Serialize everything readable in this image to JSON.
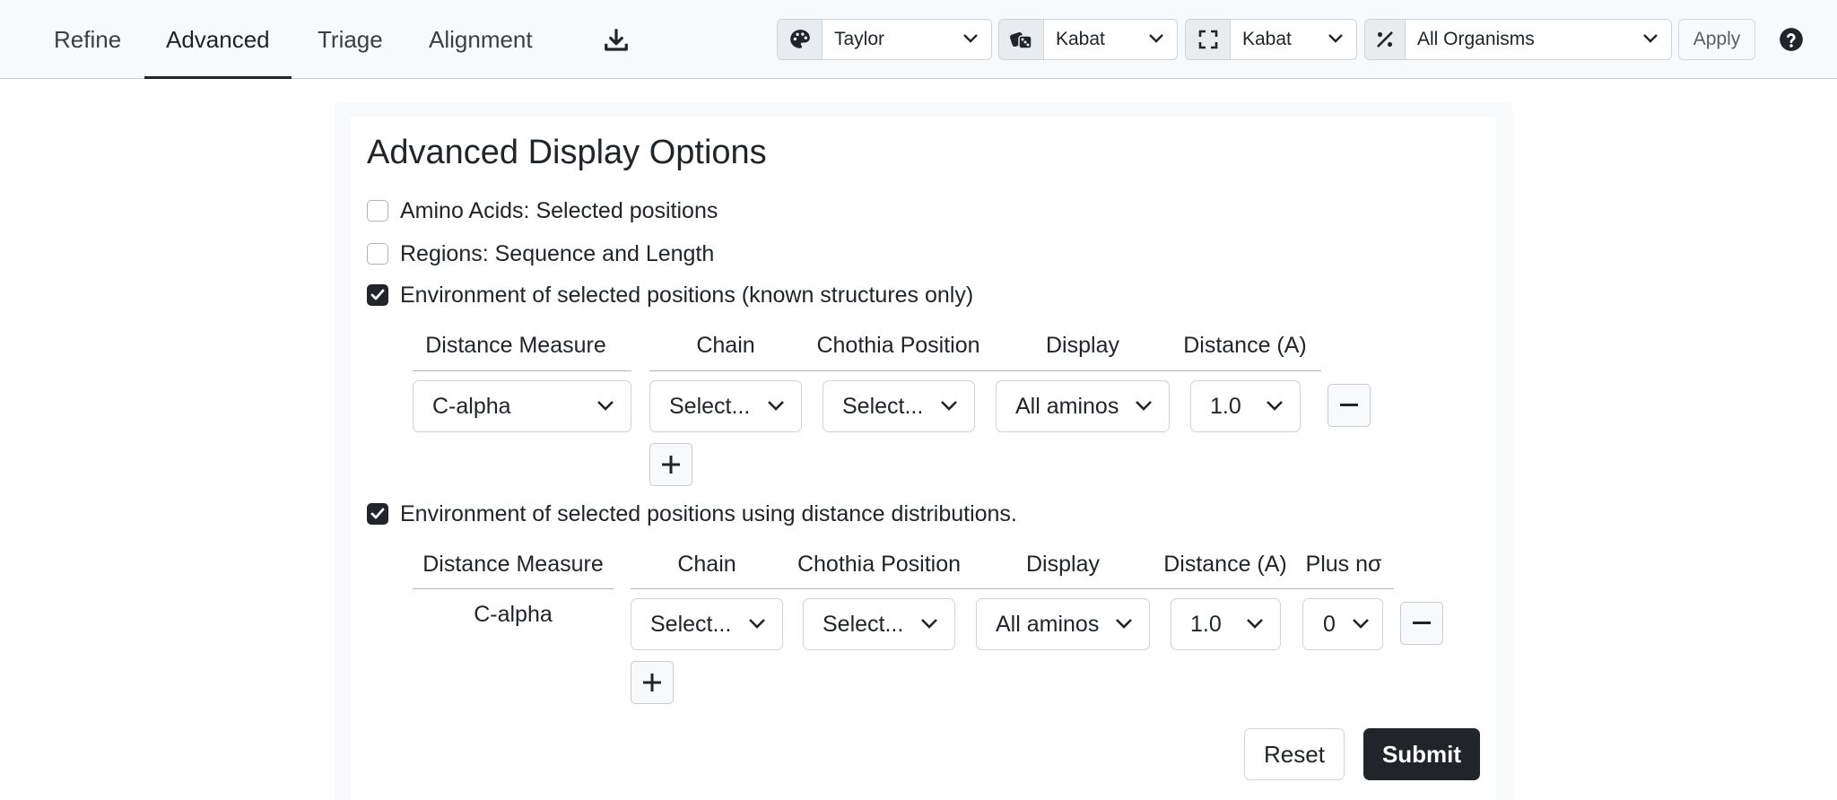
{
  "nav": {
    "tabs": [
      {
        "label": "Refine",
        "active": false
      },
      {
        "label": "Advanced",
        "active": true
      },
      {
        "label": "Triage",
        "active": false
      },
      {
        "label": "Alignment",
        "active": false
      }
    ],
    "download_icon": "download-icon",
    "controls": [
      {
        "icon": "palette-icon",
        "value": "Taylor"
      },
      {
        "icon": "dice-icon",
        "value": "Kabat"
      },
      {
        "icon": "expand-icon",
        "value": "Kabat"
      },
      {
        "icon": "percent-icon",
        "value": "All Organisms"
      }
    ],
    "apply_label": "Apply",
    "help_icon": "question-circle-icon"
  },
  "panel": {
    "title": "Advanced Display Options",
    "options": [
      {
        "label": "Amino Acids: Selected positions",
        "checked": false
      },
      {
        "label": "Regions: Sequence and Length",
        "checked": false
      },
      {
        "label": "Environment of selected positions (known structures only)",
        "checked": true
      },
      {
        "label": "Environment of selected positions using distance distributions.",
        "checked": true
      }
    ],
    "env_table": {
      "headers": [
        "Distance Measure",
        "Chain",
        "Chothia Position",
        "Display",
        "Distance (A)"
      ],
      "row": {
        "distance_measure": "C-alpha",
        "chain": "Select...",
        "chothia_position": "Select...",
        "display": "All aminos",
        "distance": "1.0"
      }
    },
    "dist_table": {
      "headers": [
        "Distance Measure",
        "Chain",
        "Chothia Position",
        "Display",
        "Distance (A)",
        "Plus nσ"
      ],
      "row": {
        "distance_measure": "C-alpha",
        "chain": "Select...",
        "chothia_position": "Select...",
        "display": "All aminos",
        "distance": "1.0",
        "plus_n_sigma": "0"
      }
    },
    "reset_label": "Reset",
    "submit_label": "Submit"
  },
  "colors": {
    "primary_dark": "#212529",
    "nav_bg": "#f8f9fa",
    "border": "#ced4da"
  }
}
